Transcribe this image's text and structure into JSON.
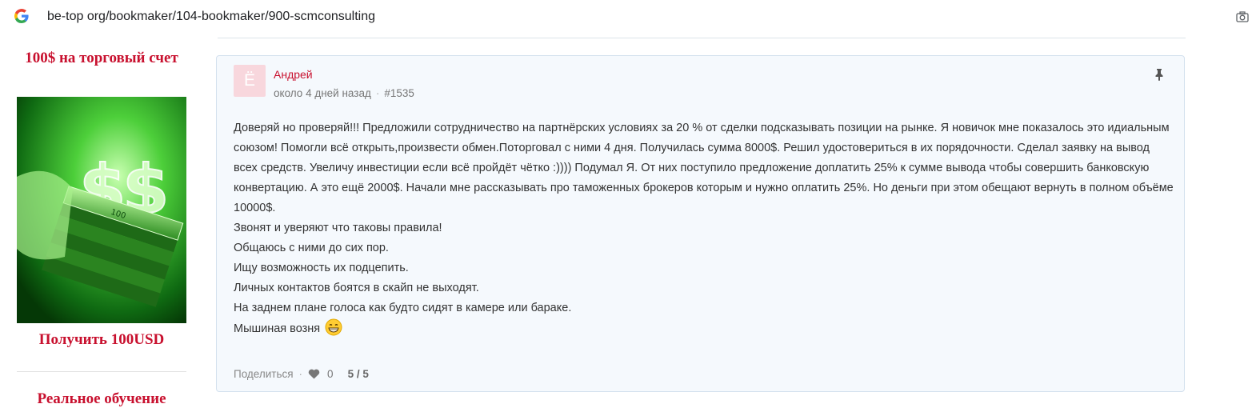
{
  "browser": {
    "url": "be-top org/bookmaker/104-bookmaker/900-scmconsulting"
  },
  "ad": {
    "title": "100$ на торговый счет",
    "cta": "Получить 100USD",
    "next_title": "Реальное обучение"
  },
  "comment": {
    "avatar_letter": "Ё",
    "author": "Андрей",
    "time": "около 4 дней назад",
    "id": "#1535",
    "paragraph": "Доверяй но проверяй!!! Предложили сотрудничество на партнёрских условиях за 20 % от сделки подсказывать позиции на рынке. Я новичок мне показалось это идиальным союзом! Помогли всё открыть,произвести обмен.Поторговал с ними 4 дня. Получилась сумма 8000$. Решил удостовериться в их порядочности. Сделал заявку на вывод всех средств. Увеличу инвестиции если всё пройдёт чётко :)))) Подумал Я. От них поступило предложение доплатить 25% к сумме вывода чтобы совершить банковскую конвертацию. А это ещё 2000$. Начали мне рассказывать про таможенных брокеров которым и нужно оплатить 25%. Но деньги при этом обещают вернуть в полном объёме 10000$.",
    "lines": [
      "Звонят и уверяют что таковы правила!",
      "Общаюсь с ними до сих пор.",
      "Ищу возможность их подцепить.",
      "Личных контактов боятся в скайп не выходят.",
      "На заднем плане голоса как будто сидят в камере или бараке."
    ],
    "last_line": "Мышиная возня",
    "share_label": "Поделиться",
    "likes": "0",
    "score": "5 / 5"
  },
  "icons": {
    "logo": "google-icon",
    "camera": "camera-icon",
    "pin": "pin-icon",
    "like": "heart-icon",
    "emoji": "grinning-face-icon"
  },
  "colors": {
    "accent": "#c8102e",
    "card_bg": "#f5f9fd",
    "card_border": "#d4e1ee",
    "avatar_bg": "#f8d7dd",
    "ad_green": "#2fa52f"
  }
}
